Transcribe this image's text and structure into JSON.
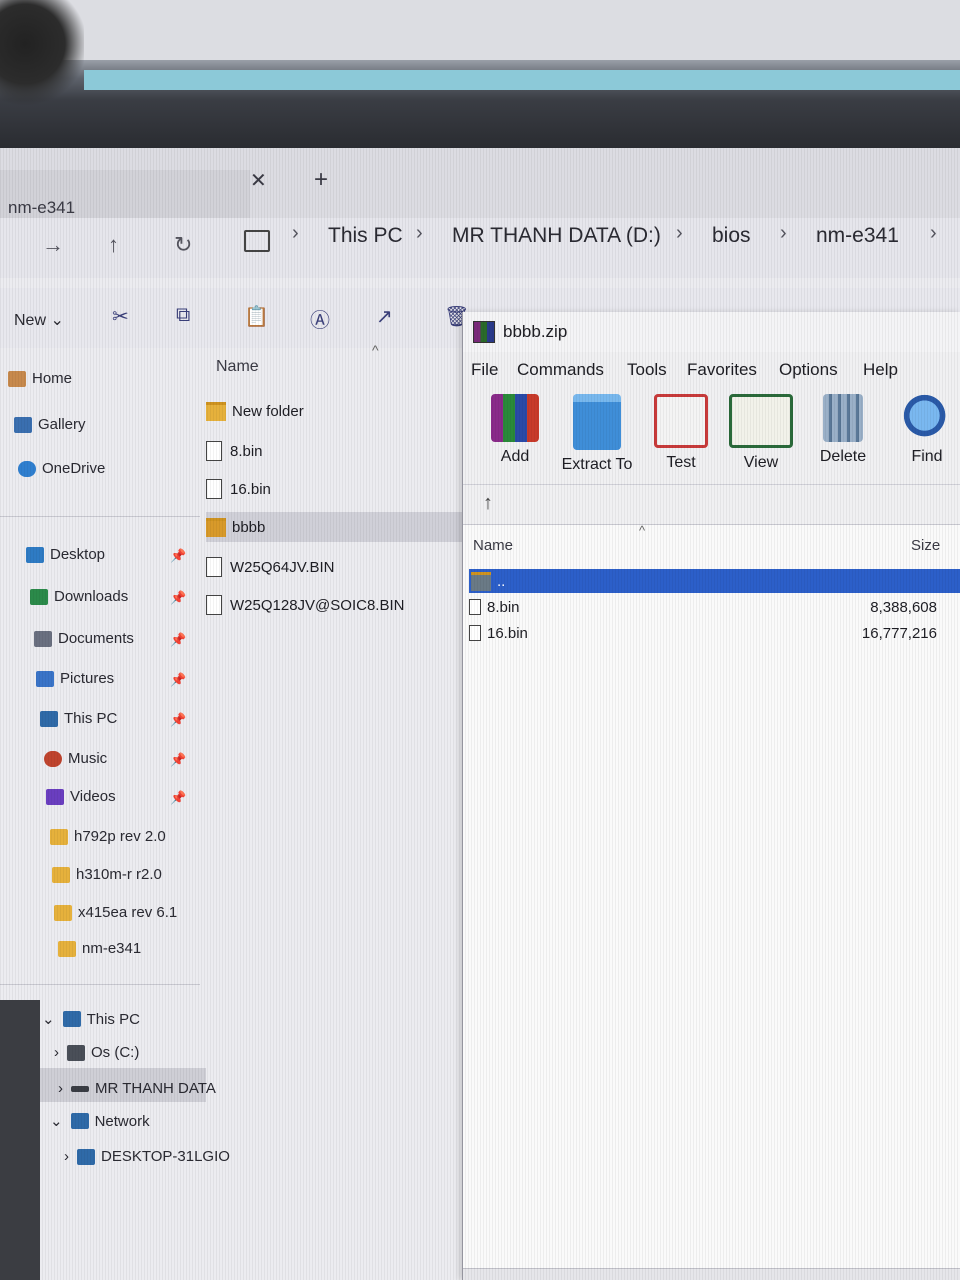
{
  "explorer": {
    "tab_title": "nm-e341",
    "tab_close": "✕",
    "tab_new": "+",
    "breadcrumbs": [
      "This PC",
      "MR THANH DATA (D:)",
      "bios",
      "nm-e341"
    ],
    "toolbar": {
      "new_label": "New"
    },
    "sidebar": {
      "quick": [
        "Home",
        "Gallery",
        "OneDrive"
      ],
      "pinned": [
        "Desktop",
        "Downloads",
        "Documents",
        "Pictures",
        "This PC",
        "Music",
        "Videos"
      ],
      "folders": [
        "h792p rev 2.0",
        "h310m-r r2.0",
        "x415ea rev 6.1",
        "nm-e341"
      ],
      "tree": [
        "This PC",
        "Os (C:)",
        "MR THANH DATA",
        "Network",
        "DESKTOP-31LGIO"
      ]
    },
    "list_header": "Name",
    "files": [
      "New folder",
      "8.bin",
      "16.bin",
      "bbbb",
      "W25Q64JV.BIN",
      "W25Q128JV@SOIC8.BIN"
    ]
  },
  "winrar": {
    "title": "bbbb.zip",
    "menu": [
      "File",
      "Commands",
      "Tools",
      "Favorites",
      "Options",
      "Help"
    ],
    "tools": [
      "Add",
      "Extract To",
      "Test",
      "View",
      "Delete",
      "Find"
    ],
    "columns": {
      "name": "Name",
      "size": "Size"
    },
    "rows": [
      {
        "name": "..",
        "size": ""
      },
      {
        "name": "8.bin",
        "size": "8,388,608"
      },
      {
        "name": "16.bin",
        "size": "16,777,216"
      }
    ]
  },
  "colors": {
    "selection": "#2c5fc9",
    "folder": "#e6b13c"
  }
}
